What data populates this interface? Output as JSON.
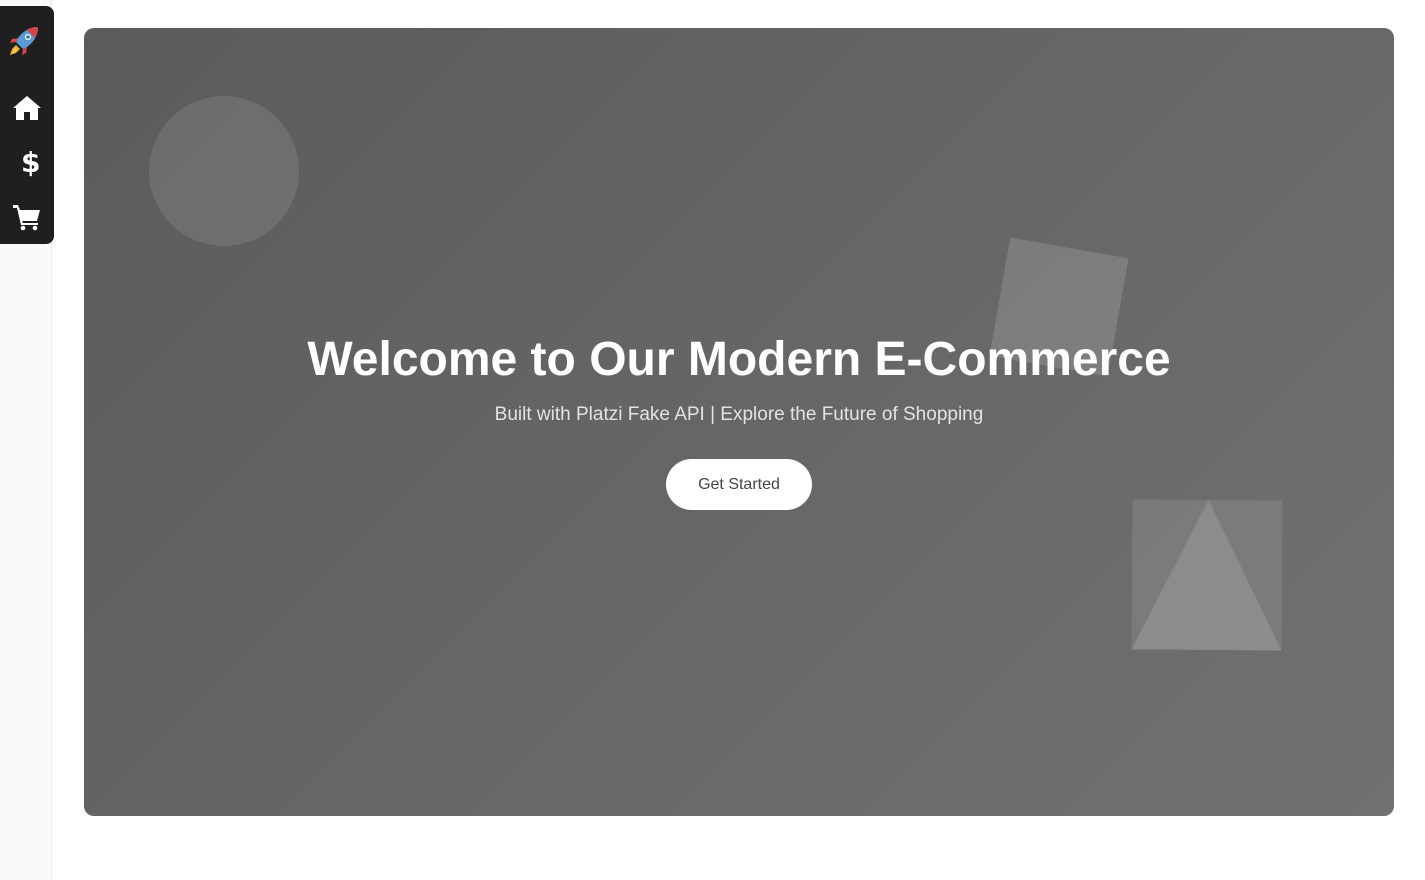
{
  "nav": {
    "items": [
      {
        "name": "logo",
        "icon": "rocket-icon"
      },
      {
        "name": "home",
        "icon": "home-icon"
      },
      {
        "name": "pricing",
        "icon": "dollar-icon"
      },
      {
        "name": "cart",
        "icon": "cart-icon"
      }
    ]
  },
  "hero": {
    "title": "Welcome to Our Modern E-Commerce",
    "subtitle": "Built with Platzi Fake API | Explore the Future of Shopping",
    "cta_label": "Get Started"
  },
  "colors": {
    "nav_bg": "#1f1f1f",
    "hero_bg_start": "#5b5b5b",
    "hero_bg_end": "#717171",
    "cta_bg": "#ffffff",
    "cta_text": "#444444"
  }
}
